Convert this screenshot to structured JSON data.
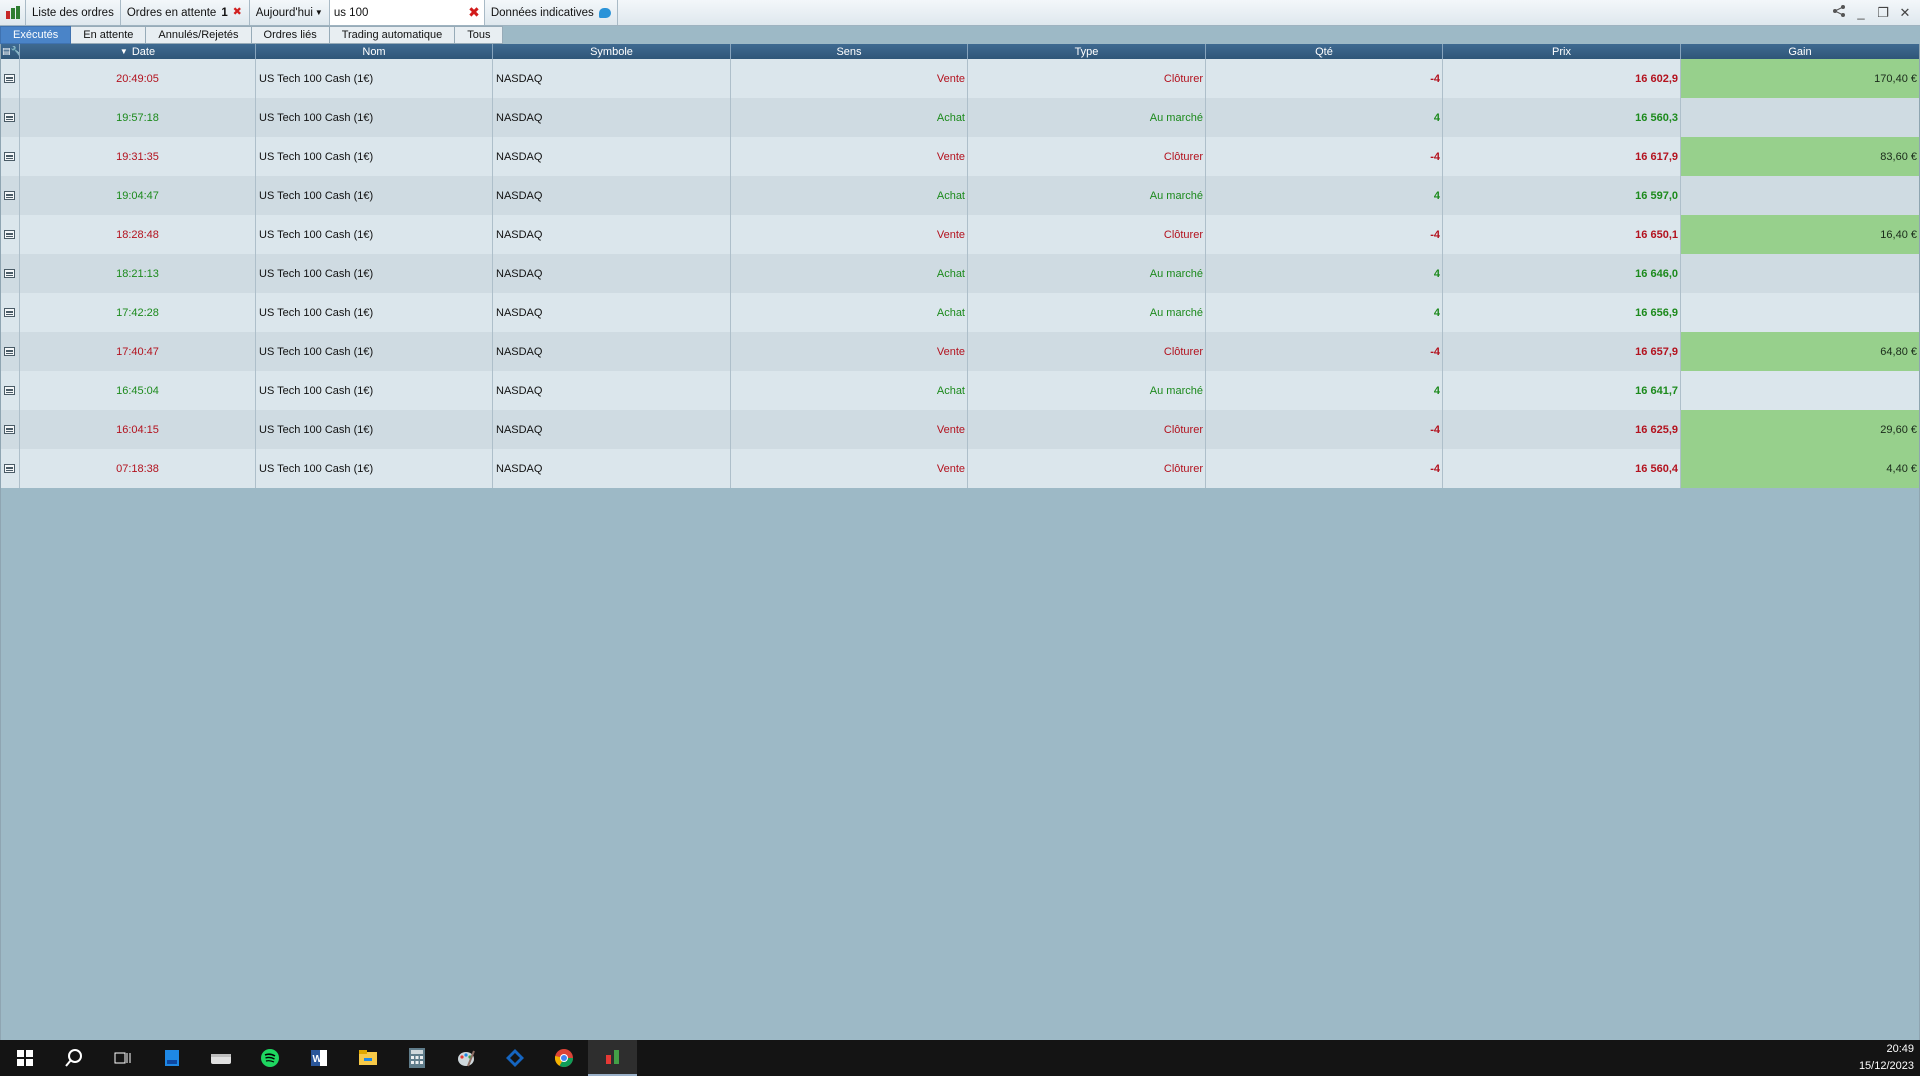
{
  "toolbar": {
    "orders_list": "Liste des ordres",
    "pending_orders": "Ordres en attente",
    "pending_count": "1",
    "period": "Aujourd'hui",
    "search_value": "us 100",
    "indicative": "Données indicatives"
  },
  "tabs": [
    {
      "label": "Exécutés",
      "active": true
    },
    {
      "label": "En attente"
    },
    {
      "label": "Annulés/Rejetés"
    },
    {
      "label": "Ordres liés"
    },
    {
      "label": "Trading automatique"
    },
    {
      "label": "Tous"
    }
  ],
  "columns": {
    "date": "Date",
    "name": "Nom",
    "symbol": "Symbole",
    "side": "Sens",
    "type": "Type",
    "qty": "Qté",
    "price": "Prix",
    "gain": "Gain"
  },
  "rows": [
    {
      "time": "20:49:05",
      "name": "US Tech 100 Cash (1€)",
      "symbol": "NASDAQ",
      "side": "Vente",
      "type": "Clôturer",
      "qty": "-4",
      "price": "16 602,9",
      "gain": "170,40 €"
    },
    {
      "time": "19:57:18",
      "name": "US Tech 100 Cash (1€)",
      "symbol": "NASDAQ",
      "side": "Achat",
      "type": "Au marché",
      "qty": "4",
      "price": "16 560,3",
      "gain": ""
    },
    {
      "time": "19:31:35",
      "name": "US Tech 100 Cash (1€)",
      "symbol": "NASDAQ",
      "side": "Vente",
      "type": "Clôturer",
      "qty": "-4",
      "price": "16 617,9",
      "gain": "83,60 €"
    },
    {
      "time": "19:04:47",
      "name": "US Tech 100 Cash (1€)",
      "symbol": "NASDAQ",
      "side": "Achat",
      "type": "Au marché",
      "qty": "4",
      "price": "16 597,0",
      "gain": ""
    },
    {
      "time": "18:28:48",
      "name": "US Tech 100 Cash (1€)",
      "symbol": "NASDAQ",
      "side": "Vente",
      "type": "Clôturer",
      "qty": "-4",
      "price": "16 650,1",
      "gain": "16,40 €"
    },
    {
      "time": "18:21:13",
      "name": "US Tech 100 Cash (1€)",
      "symbol": "NASDAQ",
      "side": "Achat",
      "type": "Au marché",
      "qty": "4",
      "price": "16 646,0",
      "gain": ""
    },
    {
      "time": "17:42:28",
      "name": "US Tech 100 Cash (1€)",
      "symbol": "NASDAQ",
      "side": "Achat",
      "type": "Au marché",
      "qty": "4",
      "price": "16 656,9",
      "gain": ""
    },
    {
      "time": "17:40:47",
      "name": "US Tech 100 Cash (1€)",
      "symbol": "NASDAQ",
      "side": "Vente",
      "type": "Clôturer",
      "qty": "-4",
      "price": "16 657,9",
      "gain": "64,80 €"
    },
    {
      "time": "16:45:04",
      "name": "US Tech 100 Cash (1€)",
      "symbol": "NASDAQ",
      "side": "Achat",
      "type": "Au marché",
      "qty": "4",
      "price": "16 641,7",
      "gain": ""
    },
    {
      "time": "16:04:15",
      "name": "US Tech 100 Cash (1€)",
      "symbol": "NASDAQ",
      "side": "Vente",
      "type": "Clôturer",
      "qty": "-4",
      "price": "16 625,9",
      "gain": "29,60 €"
    },
    {
      "time": "07:18:38",
      "name": "US Tech 100 Cash (1€)",
      "symbol": "NASDAQ",
      "side": "Vente",
      "type": "Clôturer",
      "qty": "-4",
      "price": "16 560,4",
      "gain": "4,40 €"
    }
  ],
  "colors": {
    "sell": "#b3121e",
    "buy": "#1c8a1c",
    "gain_positive": "#97d08c",
    "header": "#2f5678",
    "active_tab": "#4a84c8"
  },
  "taskbar": {
    "apps": [
      "windows-start-icon",
      "search-icon",
      "task-view-icon",
      "store-icon",
      "files-icon",
      "spotify-icon",
      "word-icon",
      "explorer-icon",
      "calculator-icon",
      "paint-icon",
      "vscode-icon",
      "chrome-icon",
      "trading-app-icon"
    ],
    "time": "20:49",
    "date": "15/12/2023"
  }
}
